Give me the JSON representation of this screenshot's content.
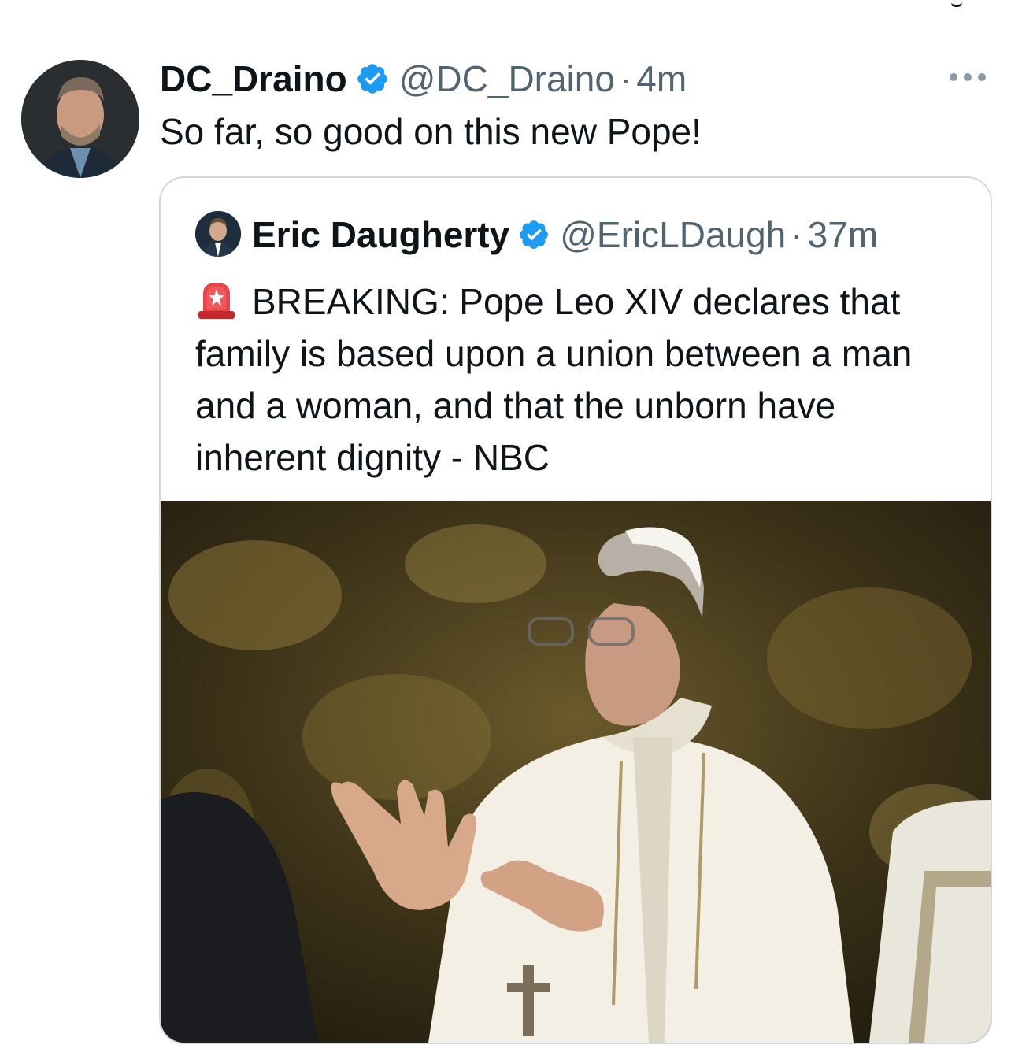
{
  "tweet": {
    "author_name": "DC_Draino",
    "author_handle": "@DC_Draino",
    "separator": "·",
    "time": "4m",
    "text": "So far, so good on this new Pope!"
  },
  "quoted": {
    "author_name": "Eric Daugherty",
    "author_handle": "@EricLDaugh",
    "separator": "·",
    "time": "37m",
    "text": "BREAKING: Pope Leo XIV declares that family is based upon a union between a man and a woman, and that the unborn have inherent dignity - NBC",
    "emoji": "siren-icon"
  },
  "colors": {
    "verified": "#1d9bf0",
    "secondary_text": "#536471",
    "border": "#cfd9de"
  }
}
